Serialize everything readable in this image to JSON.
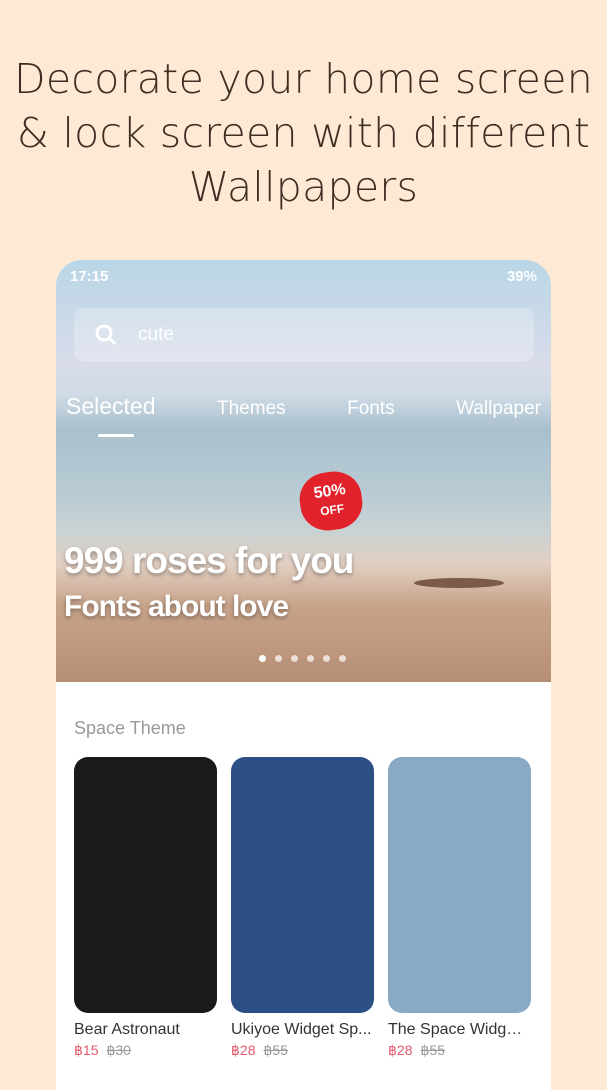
{
  "headline": "Decorate your home screen & lock screen with different Wallpapers",
  "status": {
    "time": "17:15",
    "battery": "39%"
  },
  "search": {
    "value": "cute"
  },
  "tabs": [
    {
      "label": "Selected"
    },
    {
      "label": "Themes"
    },
    {
      "label": "Fonts"
    },
    {
      "label": "Wallpaper"
    }
  ],
  "banner": {
    "line1": "999 roses for you",
    "line2": "Fonts about love",
    "badge_pct": "50%",
    "badge_off": "OFF",
    "slides": 6,
    "active_slide": 1
  },
  "section_title": "Space Theme",
  "items": [
    {
      "name": "Bear Astronaut",
      "price": "฿15",
      "old_price": "฿30",
      "color": "#1a1a1a"
    },
    {
      "name": "Ukiyoe Widget Sp...",
      "price": "฿28",
      "old_price": "฿55",
      "color": "#2c4f86"
    },
    {
      "name": "The Space Widget...",
      "price": "฿28",
      "old_price": "฿55",
      "color": "#8aa9c4"
    }
  ]
}
